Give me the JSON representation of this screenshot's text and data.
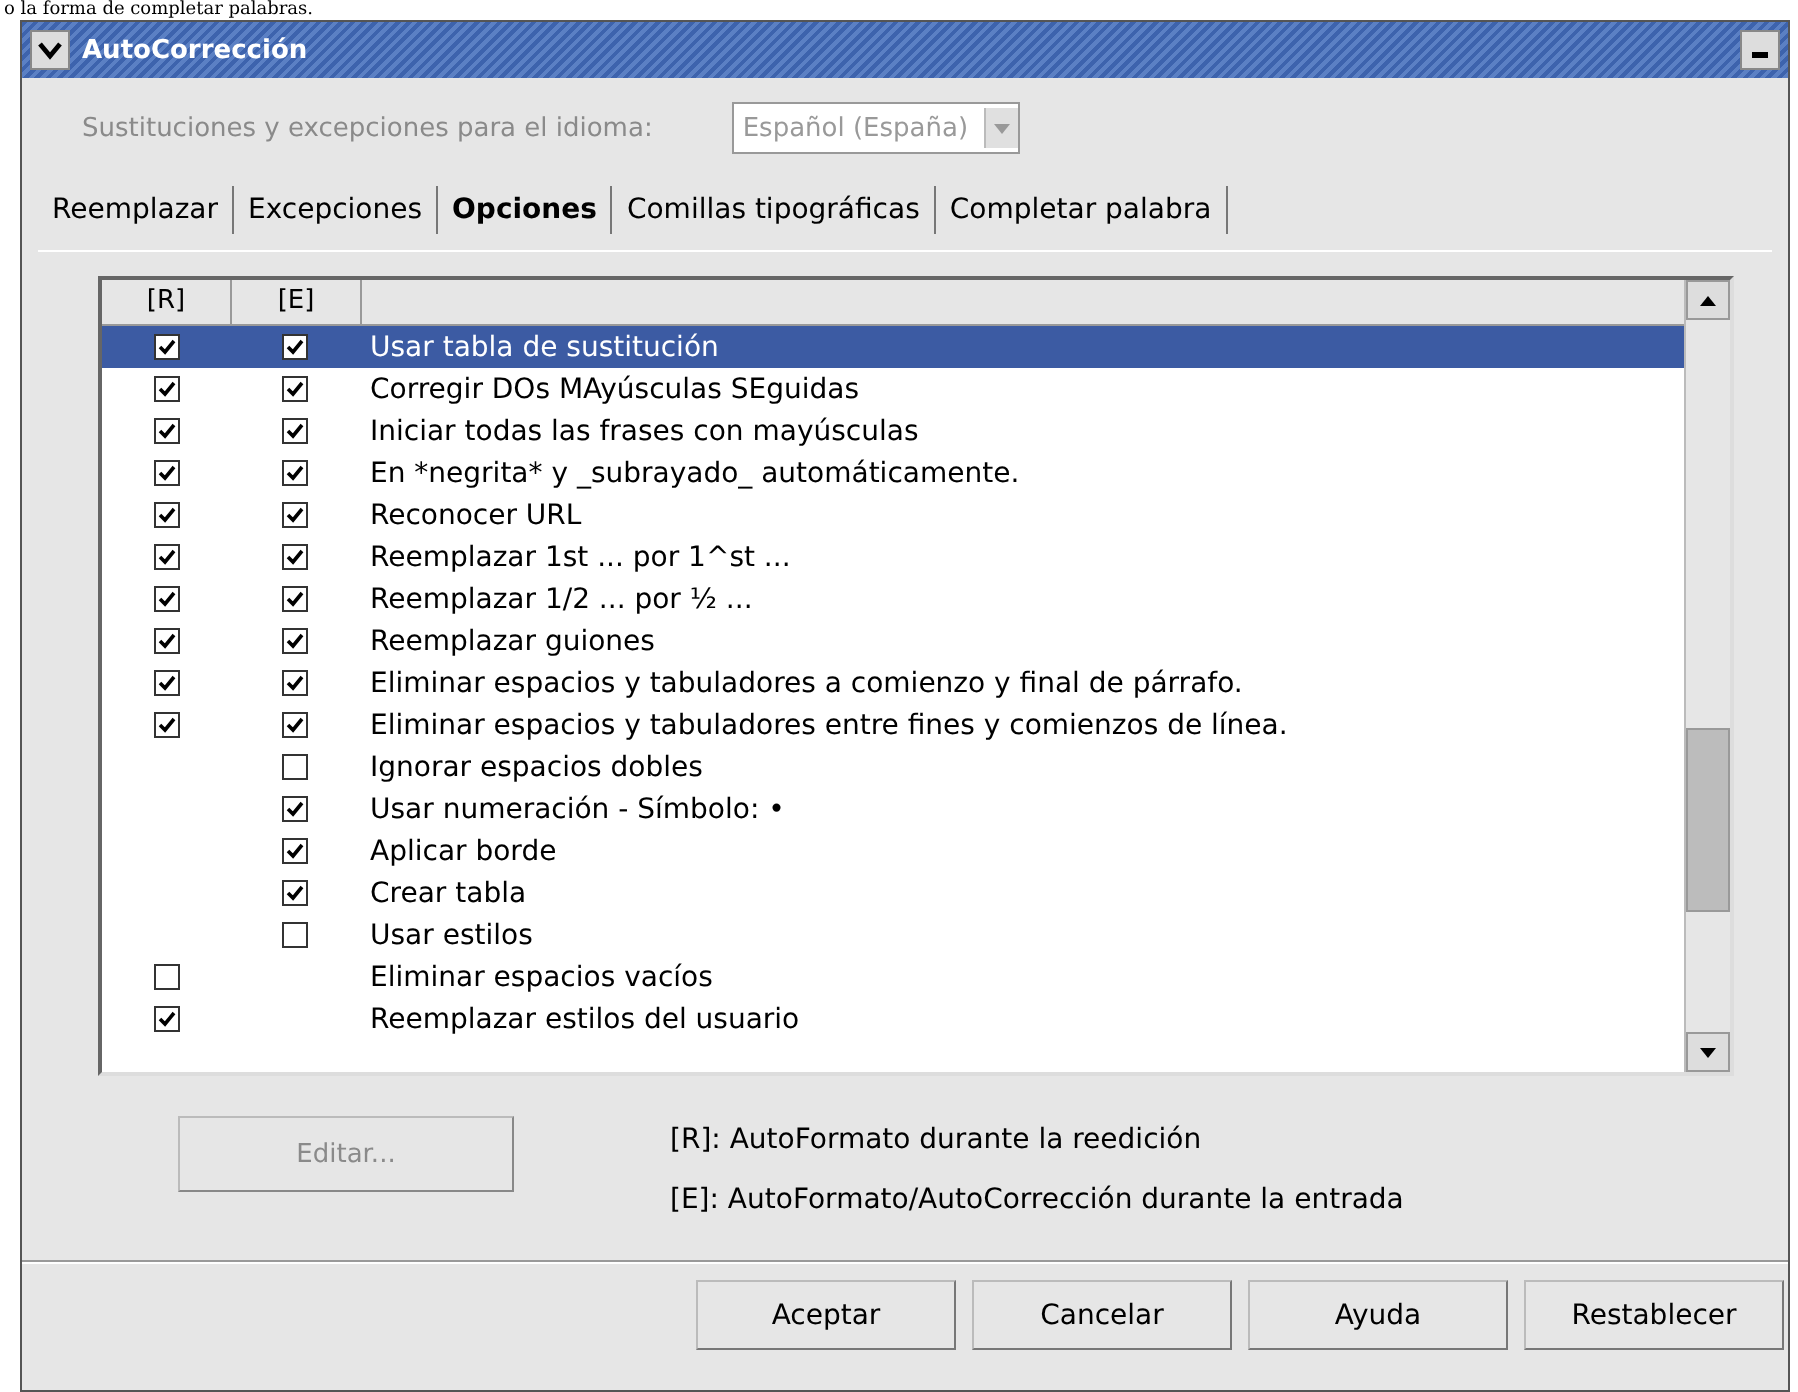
{
  "document_text": "o la forma de completar palabras.",
  "window": {
    "title": "AutoCorrección"
  },
  "language": {
    "label": "Sustituciones y excepciones para el idioma:",
    "disabled": true,
    "value": "Español (España)"
  },
  "tabs": [
    {
      "label": "Reemplazar",
      "selected": false
    },
    {
      "label": "Excepciones",
      "selected": false
    },
    {
      "label": "Opciones",
      "selected": true
    },
    {
      "label": "Comillas tipográficas",
      "selected": false
    },
    {
      "label": "Completar palabra",
      "selected": false
    }
  ],
  "options": {
    "columns": [
      "[R]",
      "[E]"
    ],
    "rows": [
      {
        "label": "Usar tabla de sustitución",
        "r": true,
        "e": true,
        "selected": true
      },
      {
        "label": "Corregir DOs MAyúsculas SEguidas",
        "r": true,
        "e": true,
        "selected": false
      },
      {
        "label": "Iniciar todas las frases con mayúsculas",
        "r": true,
        "e": true,
        "selected": false
      },
      {
        "label": "En *negrita* y _subrayado_ automáticamente.",
        "r": true,
        "e": true,
        "selected": false
      },
      {
        "label": "Reconocer URL",
        "r": true,
        "e": true,
        "selected": false
      },
      {
        "label": "Reemplazar 1st ... por 1^st ...",
        "r": true,
        "e": true,
        "selected": false
      },
      {
        "label": "Reemplazar 1/2 ... por ½ ...",
        "r": true,
        "e": true,
        "selected": false
      },
      {
        "label": "Reemplazar guiones",
        "r": true,
        "e": true,
        "selected": false
      },
      {
        "label": "Eliminar espacios y tabuladores a comienzo y final de párrafo.",
        "r": true,
        "e": true,
        "selected": false
      },
      {
        "label": "Eliminar espacios y tabuladores entre fines y comienzos de línea.",
        "r": true,
        "e": true,
        "selected": false
      },
      {
        "label": "Ignorar espacios dobles",
        "e": false,
        "selected": false
      },
      {
        "label": "Usar numeración - Símbolo: •",
        "e": true,
        "selected": false
      },
      {
        "label": "Aplicar borde",
        "e": true,
        "selected": false
      },
      {
        "label": "Crear tabla",
        "e": true,
        "selected": false
      },
      {
        "label": "Usar estilos",
        "e": false,
        "selected": false
      },
      {
        "label": "Eliminar espacios vacíos",
        "r": false,
        "selected": false
      },
      {
        "label": "Reemplazar estilos del usuario",
        "r": true,
        "selected": false
      }
    ]
  },
  "edit_button": {
    "label": "Editar...",
    "disabled": true
  },
  "legend": [
    "[R]: AutoFormato durante la reedición",
    "[E]: AutoFormato/AutoCorrección durante la entrada"
  ],
  "buttons": [
    "Aceptar",
    "Cancelar",
    "Ayuda",
    "Restablecer"
  ]
}
